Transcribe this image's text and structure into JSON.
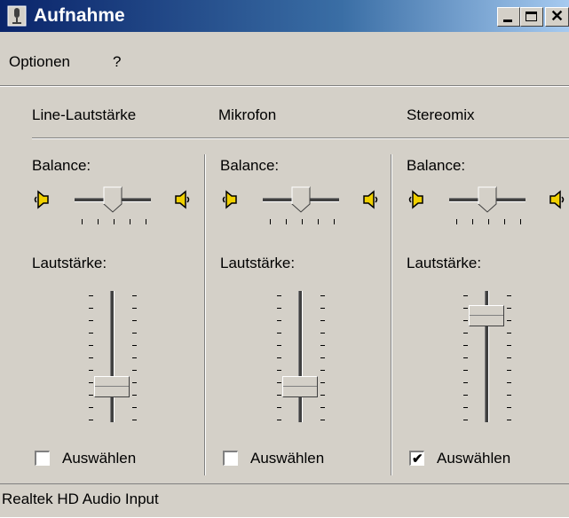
{
  "window": {
    "title": "Aufnahme"
  },
  "menu": {
    "items": [
      "Optionen",
      "?"
    ]
  },
  "channels": [
    {
      "name": "Line-Lautstärke",
      "balance_label": "Balance:",
      "volume_label": "Lautstärke:",
      "volume_level": 0.2,
      "select_label": "Auswählen",
      "selected": false
    },
    {
      "name": "Mikrofon",
      "balance_label": "Balance:",
      "volume_label": "Lautstärke:",
      "volume_level": 0.2,
      "select_label": "Auswählen",
      "selected": false
    },
    {
      "name": "Stereomix",
      "balance_label": "Balance:",
      "volume_label": "Lautstärke:",
      "volume_level": 0.85,
      "select_label": "Auswählen",
      "selected": true
    }
  ],
  "status": {
    "text": "Realtek HD Audio Input"
  },
  "colors": {
    "face": "#d4d0c8",
    "title_start": "#0a246a",
    "title_end": "#a6caf0",
    "speaker": "#f0d000"
  },
  "icons": {
    "left_speaker": "speaker-left-icon",
    "right_speaker": "speaker-right-icon",
    "check": "✔"
  }
}
